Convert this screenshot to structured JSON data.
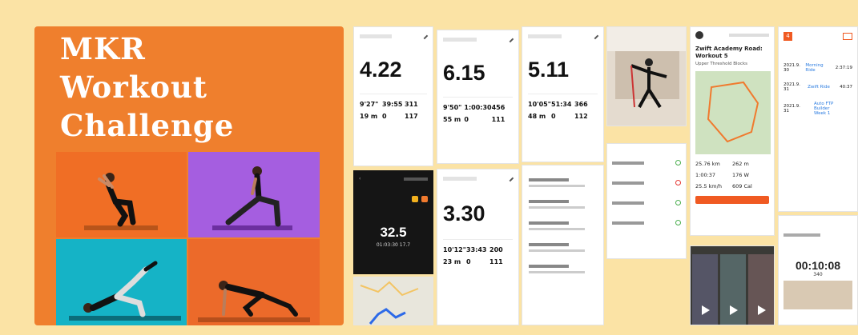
{
  "poster": {
    "title_line1": "MKR",
    "title_line2": "Workout",
    "title_line3": "Challenge"
  },
  "tiles": [
    {
      "bg": "#f06e25",
      "pose": "squat"
    },
    {
      "bg": "#a55ee0",
      "pose": "lunge"
    },
    {
      "bg": "#15b3c6",
      "pose": "glute-bridge"
    },
    {
      "bg": "#ec6a2a",
      "pose": "mountain-climber"
    }
  ],
  "screens": {
    "run1": {
      "distance": "4.22",
      "pace": "9'27\"",
      "time": "39:55",
      "cal": "311",
      "elev": "19 m",
      "hr": "0",
      "cadence": "117"
    },
    "run2": {
      "distance": "6.15",
      "pace": "9'50\"",
      "time": "1:00:30",
      "cal": "456",
      "elev": "55 m",
      "hr": "0",
      "cadence": "111"
    },
    "run3": {
      "distance": "5.11",
      "pace": "10'05\"",
      "time": "51:34",
      "cal": "366",
      "elev": "48 m",
      "hr": "0",
      "cadence": "112"
    },
    "run4": {
      "distance": "3.30",
      "pace": "10'12\"",
      "time": "33:43",
      "cal": "200",
      "elev": "23 m",
      "hr": "0",
      "cadence": "111"
    },
    "treadmill": {
      "value": "32.5",
      "subvalue": "01:03:30 17.7"
    },
    "zwift": {
      "title": "Zwift Academy Road: Workout 5",
      "subtitle": "Upper Threshold Blocks",
      "dist": "25.76 km",
      "elev": "262 m",
      "time": "1:00:37",
      "watts": "176 W",
      "speed": "25.5 km/h",
      "cal": "609 Cal"
    },
    "timer": {
      "value": "00:10:08",
      "sub": "340"
    },
    "table": {
      "badge": "4",
      "rows": [
        {
          "d": "2021.9. 30",
          "link": "Morning Ride",
          "v": "2:37:19"
        },
        {
          "d": "2021.9. 31",
          "link": "Zwift Ride",
          "v": "40:37"
        },
        {
          "d": "2021.9. 31",
          "link": "Auto FTP Builder Week 1",
          "v": ""
        }
      ]
    }
  }
}
